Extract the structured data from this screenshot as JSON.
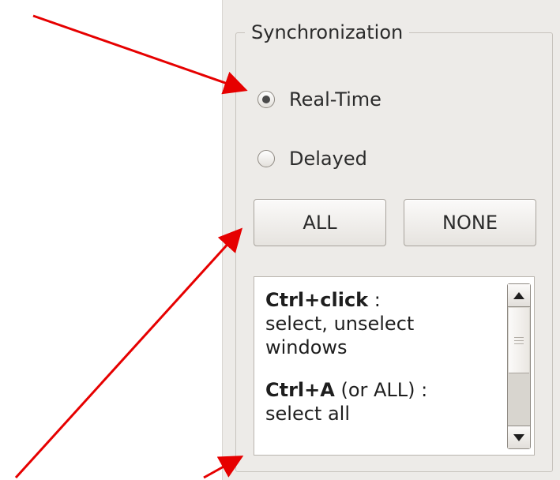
{
  "sync_group": {
    "title": "Synchronization",
    "options": [
      {
        "label": "Real-Time",
        "selected": true
      },
      {
        "label": "Delayed",
        "selected": false
      }
    ],
    "buttons": {
      "all": "ALL",
      "none": "NONE"
    }
  },
  "help": {
    "items": [
      {
        "shortcut": "Ctrl+click",
        "rest": " :",
        "line2": "select, unselect",
        "line3": "windows"
      },
      {
        "shortcut": "Ctrl+A",
        "rest": " (or ALL) :",
        "line2": "select all"
      }
    ]
  },
  "colors": {
    "annotation_arrow": "#e60000",
    "panel_bg": "#edebe8"
  }
}
